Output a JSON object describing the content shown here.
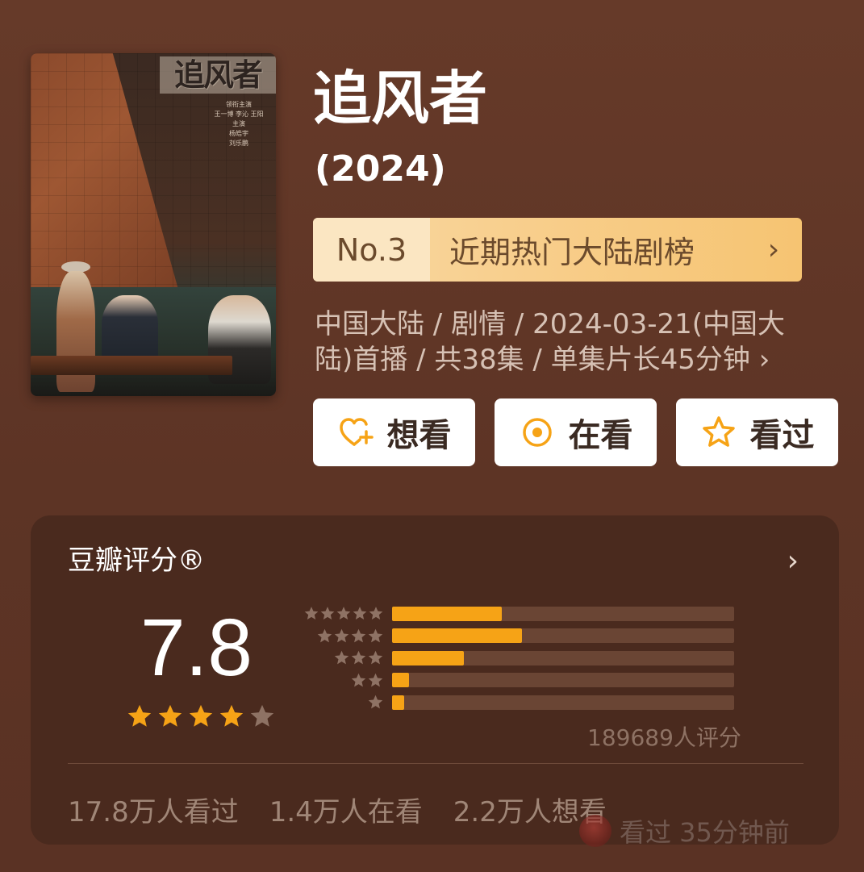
{
  "poster": {
    "title": "追风者",
    "credits_lines": [
      "领衔主演",
      "王一博 李沁 王阳",
      "主演",
      "杨皓宇",
      "刘乐鹏"
    ]
  },
  "title": "追风者",
  "year": "(2024)",
  "rank": {
    "number": "No.3",
    "label": "近期热门大陆剧榜",
    "chevron": "›"
  },
  "meta": "中国大陆 / 剧情 / 2024-03-21(中国大陆)首播 / 共38集 / 单集片长45分钟 ›",
  "actions": [
    {
      "icon": "heart-plus-icon",
      "label": "想看"
    },
    {
      "icon": "target-icon",
      "label": "在看"
    },
    {
      "icon": "star-outline-icon",
      "label": "看过"
    }
  ],
  "rating": {
    "title": "豆瓣评分®",
    "chevron": "›",
    "score": "7.8",
    "stars": 4,
    "distribution": [
      {
        "stars": 5,
        "fraction": 0.32
      },
      {
        "stars": 4,
        "fraction": 0.38
      },
      {
        "stars": 3,
        "fraction": 0.21
      },
      {
        "stars": 2,
        "fraction": 0.05
      },
      {
        "stars": 1,
        "fraction": 0.035
      }
    ],
    "count": "189689人评分"
  },
  "stats": [
    "17.8万人看过",
    "1.4万人在看",
    "2.2万人想看"
  ],
  "watermark": {
    "text": "看过 35分钟前"
  },
  "colors": {
    "background": "#5e3526",
    "card": "#4a2a1e",
    "accent_orange": "#f6a316",
    "badge_text": "#6b4a2c",
    "star_gray": "#8e7264"
  }
}
